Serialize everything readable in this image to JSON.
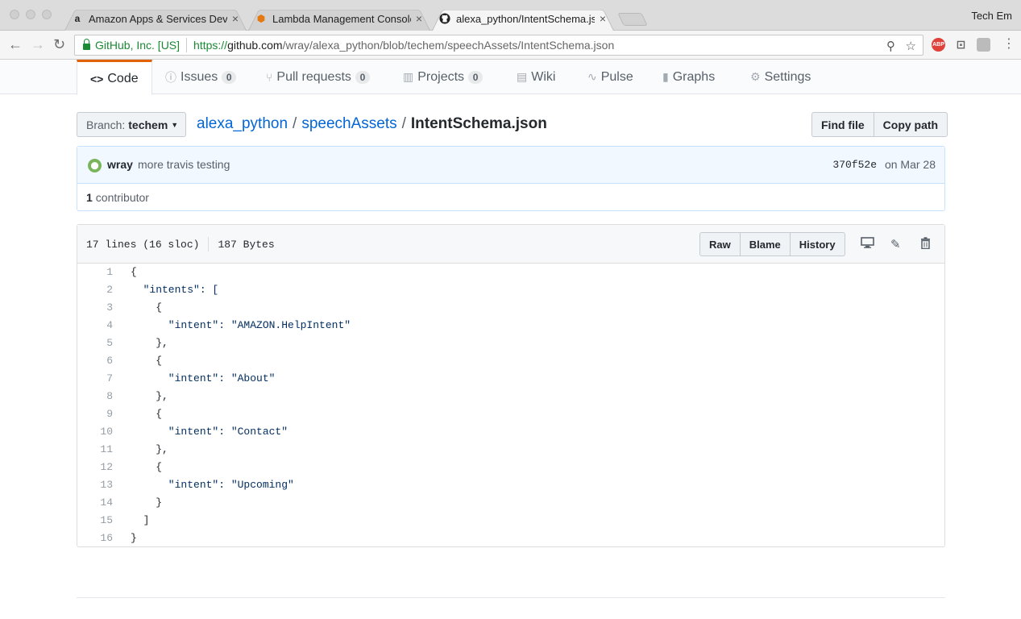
{
  "browser": {
    "tabs": [
      {
        "title": "Amazon Apps & Services Developer Portal",
        "icon": "amazon-icon"
      },
      {
        "title": "Lambda Management Console",
        "icon": "aws-lambda-icon"
      },
      {
        "title": "alexa_python/IntentSchema.json",
        "icon": "github-icon"
      }
    ],
    "profile": "Tech Em",
    "security_label": "GitHub, Inc. [US]",
    "url_scheme": "https://",
    "url_host": "github.com",
    "url_path": "/wray/alexa_python/blob/techem/speechAssets/IntentSchema.json",
    "abp_label": "ABP"
  },
  "reponav": {
    "code": "Code",
    "issues": "Issues",
    "issues_count": "0",
    "pulls": "Pull requests",
    "pulls_count": "0",
    "projects": "Projects",
    "projects_count": "0",
    "wiki": "Wiki",
    "pulse": "Pulse",
    "graphs": "Graphs",
    "settings": "Settings"
  },
  "file_nav": {
    "branch_label": "Branch:",
    "branch_name": "techem",
    "repo": "alexa_python",
    "folder": "speechAssets",
    "separator": "/",
    "filename": "IntentSchema.json",
    "find_file": "Find file",
    "copy_path": "Copy path"
  },
  "commit": {
    "author": "wray",
    "message": "more travis testing",
    "sha": "370f52e",
    "date": "on Mar 28",
    "contributors_count": "1",
    "contributors_label": "contributor"
  },
  "file": {
    "lines_info": "17 lines (16 sloc)",
    "size": "187 Bytes",
    "raw": "Raw",
    "blame": "Blame",
    "history": "History",
    "lines": [
      {
        "n": "1",
        "text": "{"
      },
      {
        "n": "2",
        "text": "  \"intents\": ["
      },
      {
        "n": "3",
        "text": "    {"
      },
      {
        "n": "4",
        "text": "      \"intent\": \"AMAZON.HelpIntent\""
      },
      {
        "n": "5",
        "text": "    },"
      },
      {
        "n": "6",
        "text": "    {"
      },
      {
        "n": "7",
        "text": "      \"intent\": \"About\""
      },
      {
        "n": "8",
        "text": "    },"
      },
      {
        "n": "9",
        "text": "    {"
      },
      {
        "n": "10",
        "text": "      \"intent\": \"Contact\""
      },
      {
        "n": "11",
        "text": "    },"
      },
      {
        "n": "12",
        "text": "    {"
      },
      {
        "n": "13",
        "text": "      \"intent\": \"Upcoming\""
      },
      {
        "n": "14",
        "text": "    }"
      },
      {
        "n": "15",
        "text": "  ]"
      },
      {
        "n": "16",
        "text": "}"
      }
    ]
  },
  "colors": {
    "link": "#0366d6",
    "selected_tab_accent": "#e36209",
    "secure_green": "#1a8a35",
    "commit_bg": "#f1f8ff"
  }
}
